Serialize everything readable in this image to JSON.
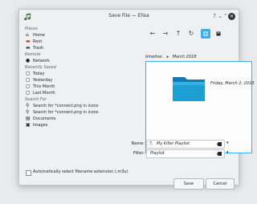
{
  "window": {
    "title": "Save File — Elisa"
  },
  "titlebar": {
    "help": "?",
    "minimize": "⌄",
    "maximize": "⌃",
    "close": "✕"
  },
  "places": [
    {
      "type": "section",
      "label": "Places"
    },
    {
      "type": "item",
      "label": "Home",
      "icon": "home-icon"
    },
    {
      "type": "item",
      "label": "Root",
      "icon": "root-folder-icon"
    },
    {
      "type": "item",
      "label": "Trash",
      "icon": "trash-icon"
    },
    {
      "type": "section",
      "label": "Remote"
    },
    {
      "type": "item",
      "label": "Network",
      "icon": "network-icon"
    },
    {
      "type": "section",
      "label": "Recently Saved"
    },
    {
      "type": "item",
      "label": "Today",
      "icon": "calendar-icon"
    },
    {
      "type": "item",
      "label": "Yesterday",
      "icon": "calendar-icon"
    },
    {
      "type": "item",
      "label": "This Month",
      "icon": "calendar-icon"
    },
    {
      "type": "item",
      "label": "Last Month",
      "icon": "calendar-icon"
    },
    {
      "type": "section",
      "label": "Search For"
    },
    {
      "type": "item",
      "label": "Search for *connect.png in icons",
      "icon": "search-icon"
    },
    {
      "type": "item",
      "label": "Search for *connect.png in icons",
      "icon": "search-icon"
    },
    {
      "type": "item",
      "label": "Documents",
      "icon": "documents-icon"
    },
    {
      "type": "item",
      "label": "Images",
      "icon": "images-icon"
    }
  ],
  "toolbar": {
    "back": "←",
    "forward": "→",
    "up": "↑",
    "reload": "↻"
  },
  "breadcrumb": {
    "root": "timeline:",
    "separator": "▸",
    "current": "March 2018"
  },
  "files": [
    {
      "name": "Friday, March 2, 2018",
      "icon": "folder-icon"
    }
  ],
  "name_field": {
    "label": "Name:",
    "value": "My Killer Playlist"
  },
  "filter_field": {
    "label": "Filter:",
    "value": "Playlist"
  },
  "options": {
    "auto_extension": "Automatically select filename extension (.m3u)"
  },
  "buttons": {
    "save": "Save",
    "cancel": "Cancel"
  },
  "colors": {
    "accent": "#3daee9",
    "folder": "#1e9fd3"
  }
}
